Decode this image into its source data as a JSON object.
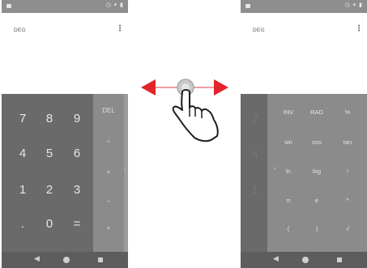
{
  "left_phone": {
    "mode": "DEG",
    "menu_icon": "overflow-menu-icon",
    "number_keys": [
      "7",
      "8",
      "9",
      "4",
      "5",
      "6",
      "1",
      "2",
      "3",
      ".",
      "0",
      "="
    ],
    "operator_keys": [
      "DEL",
      "÷",
      "×",
      "−",
      "+"
    ],
    "edge_icon": "chevron-left-icon"
  },
  "right_phone": {
    "mode": "DEG",
    "menu_icon": "overflow-menu-icon",
    "ghost_digits": [
      "7",
      "4",
      "1"
    ],
    "functions": [
      "INV",
      "RAD",
      "%",
      "sin",
      "cos",
      "tan",
      "ln",
      "log",
      "!",
      "π",
      "e",
      "^",
      "(",
      ")",
      "√"
    ],
    "panel_icon": "chevron-right-icon"
  },
  "navbar": {
    "back_icon": "back-icon",
    "home_icon": "home-icon",
    "recent_icon": "recent-apps-icon"
  },
  "gesture": {
    "type": "horizontal-swipe",
    "icon": "hand-swipe-icon",
    "arrow_color": "#e3242b",
    "track_color": "#f0a0a0"
  },
  "colors": {
    "numpad": "#6a6a6a",
    "oppad": "#8b8b8b",
    "statusbar": "#8e8e8e",
    "navbar": "#5d5d5d"
  }
}
